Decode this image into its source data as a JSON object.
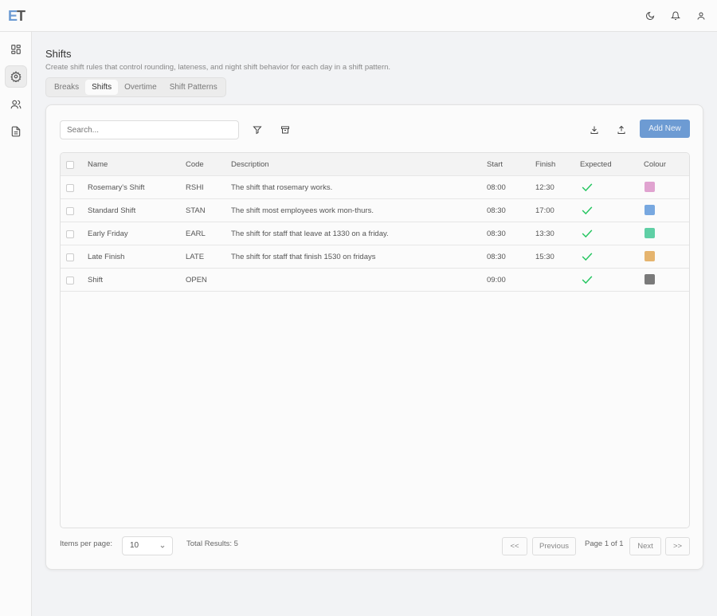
{
  "logo": {
    "e": "E",
    "t": "T"
  },
  "page": {
    "title": "Shifts",
    "subtitle": "Create shift rules that control rounding, lateness, and night shift behavior for each day in a shift pattern."
  },
  "tabs": [
    "Breaks",
    "Shifts",
    "Overtime",
    "Shift Patterns"
  ],
  "toolbar": {
    "search_placeholder": "Search...",
    "add_label": "Add New"
  },
  "table": {
    "headers": [
      "Name",
      "Code",
      "Description",
      "Start",
      "Finish",
      "Expected",
      "Colour"
    ],
    "rows": [
      {
        "name": "Rosemary's Shift",
        "code": "RSHI",
        "description": "The shift that rosemary works.",
        "start": "08:00",
        "finish": "12:30",
        "expected": true,
        "colour": "#e0a3d0"
      },
      {
        "name": "Standard Shift",
        "code": "STAN",
        "description": "The shift most employees work mon-thurs.",
        "start": "08:30",
        "finish": "17:00",
        "expected": true,
        "colour": "#78a8e0"
      },
      {
        "name": "Early Friday",
        "code": "EARL",
        "description": "The shift for staff that leave at 1330 on a friday.",
        "start": "08:30",
        "finish": "13:30",
        "expected": true,
        "colour": "#5fcfa5"
      },
      {
        "name": "Late Finish",
        "code": "LATE",
        "description": "The shift for staff that finish 1530 on fridays",
        "start": "08:30",
        "finish": "15:30",
        "expected": true,
        "colour": "#e5b46e"
      },
      {
        "name": "Shift",
        "code": "OPEN",
        "description": "",
        "start": "09:00",
        "finish": "",
        "expected": true,
        "colour": "#7a7a7a"
      }
    ]
  },
  "footer": {
    "items_label": "Items per page:",
    "items_value": "10",
    "total": "Total Results: 5",
    "first": "<<",
    "prev": "Previous",
    "page": "Page 1 of 1",
    "next": "Next",
    "last": ">>"
  }
}
